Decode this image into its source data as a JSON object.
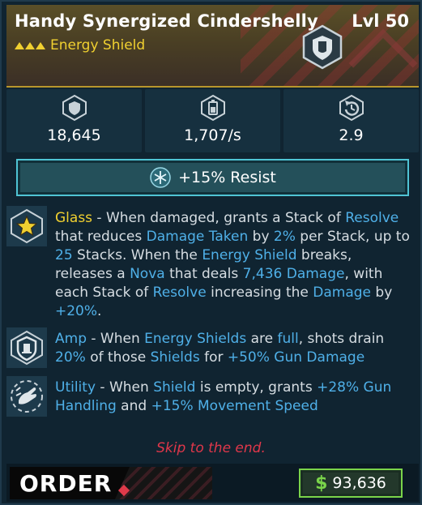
{
  "item": {
    "name": "Handy Synergized Cindershelly",
    "level": "Lvl 50",
    "type": "Energy Shield",
    "rarity_icon": "rarity-chevrons-icon",
    "badge_icon": "energy-shield-icon"
  },
  "stats": [
    {
      "icon": "shield-capacity-icon",
      "value": "18,645"
    },
    {
      "icon": "recharge-rate-icon",
      "value": "1,707/s"
    },
    {
      "icon": "recharge-delay-icon",
      "value": "2.9"
    }
  ],
  "resist": {
    "icon": "cryo-snowflake-icon",
    "label": "+15% Resist"
  },
  "perks": [
    {
      "icon": "glass-star-icon",
      "segments": [
        {
          "t": "Glass",
          "c": "gold"
        },
        {
          "t": " - When damaged, grants a Stack of ",
          "c": ""
        },
        {
          "t": "Resolve",
          "c": "hl"
        },
        {
          "t": " that reduces ",
          "c": ""
        },
        {
          "t": "Damage Taken",
          "c": "hl"
        },
        {
          "t": " by ",
          "c": ""
        },
        {
          "t": "2%",
          "c": "hl"
        },
        {
          "t": " per Stack, up to ",
          "c": ""
        },
        {
          "t": "25",
          "c": "hl"
        },
        {
          "t": " Stacks. When the ",
          "c": ""
        },
        {
          "t": "Energy Shield",
          "c": "hl"
        },
        {
          "t": " breaks, releases a ",
          "c": ""
        },
        {
          "t": "Nova",
          "c": "hl"
        },
        {
          "t": " that deals ",
          "c": ""
        },
        {
          "t": "7,436 Damage",
          "c": "hl"
        },
        {
          "t": ", with each Stack of ",
          "c": ""
        },
        {
          "t": "Resolve",
          "c": "hl"
        },
        {
          "t": " increasing the ",
          "c": ""
        },
        {
          "t": "Damage",
          "c": "hl"
        },
        {
          "t": " by ",
          "c": ""
        },
        {
          "t": "+20%",
          "c": "hl"
        },
        {
          "t": ".",
          "c": ""
        }
      ]
    },
    {
      "icon": "amp-shield-icon",
      "segments": [
        {
          "t": "Amp",
          "c": "hl"
        },
        {
          "t": " - When ",
          "c": ""
        },
        {
          "t": "Energy Shields",
          "c": "hl"
        },
        {
          "t": " are ",
          "c": ""
        },
        {
          "t": "full",
          "c": "hl"
        },
        {
          "t": ", shots drain ",
          "c": ""
        },
        {
          "t": "20%",
          "c": "hl"
        },
        {
          "t": " of those ",
          "c": ""
        },
        {
          "t": "Shields",
          "c": "hl"
        },
        {
          "t": " for ",
          "c": ""
        },
        {
          "t": "+50% Gun Damage",
          "c": "hl"
        }
      ]
    },
    {
      "icon": "utility-hand-icon",
      "segments": [
        {
          "t": "Utility",
          "c": "hl"
        },
        {
          "t": " - When ",
          "c": ""
        },
        {
          "t": "Shield",
          "c": "hl"
        },
        {
          "t": " is empty, grants ",
          "c": ""
        },
        {
          "t": "+28% Gun Handling",
          "c": "hl"
        },
        {
          "t": " and ",
          "c": ""
        },
        {
          "t": "+15% Movement Speed",
          "c": "hl"
        }
      ]
    }
  ],
  "skip_link": "Skip to the end.",
  "manufacturer": "ORDER",
  "price": {
    "symbol": "$",
    "value": "93,636"
  },
  "colors": {
    "accent_blue": "#4fb0e8",
    "gold": "#f0d030",
    "red": "#e0374a",
    "money_green": "#7ad44a"
  }
}
